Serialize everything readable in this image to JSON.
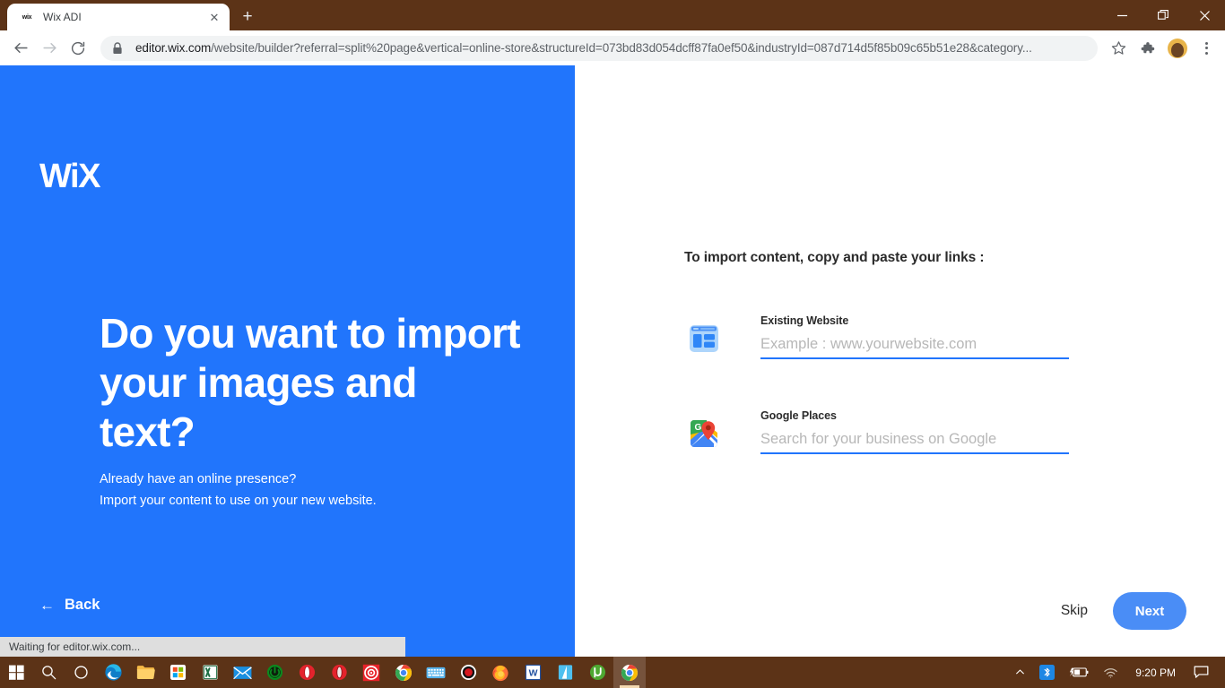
{
  "browser": {
    "tab": {
      "favicon_label": "wix",
      "favicon_icon": "wix-favicon",
      "title": "Wix ADI",
      "close_icon": "close-icon"
    },
    "newtab_icon": "plus-icon",
    "window_controls": {
      "minimize": "minimize-icon",
      "maximize": "restore-icon",
      "close": "close-icon"
    },
    "toolbar": {
      "back_icon": "back-arrow-icon",
      "forward_icon": "forward-arrow-icon",
      "reload_icon": "reload-icon",
      "lock_icon": "lock-icon",
      "url_domain": "editor.wix.com",
      "url_path": "/website/builder?referral=split%20page&vertical=online-store&structureId=073bd83d054dcff87fa0ef50&industryId=087d714d5f85b09c65b51e28&category...",
      "bookmark_icon": "star-icon",
      "extensions_icon": "puzzle-icon",
      "profile_icon": "avatar",
      "menu_icon": "three-dot-menu-icon"
    }
  },
  "hero": {
    "logo": "WiX",
    "heading": "Do you want to import your images and text?",
    "subtitle_line1": "Already have an online presence?",
    "subtitle_line2": "Import your content to use on your new website.",
    "back_label": "Back",
    "back_arrow": "←",
    "background_color": "#2175fc"
  },
  "form": {
    "title": "To import content, copy and paste your links :",
    "fields": [
      {
        "label": "Existing Website",
        "placeholder": "Example : www.yourwebsite.com",
        "value": "",
        "icon": "website-layout-icon"
      },
      {
        "label": "Google Places",
        "placeholder": "Search for your business on Google",
        "value": "",
        "icon": "google-maps-icon"
      }
    ],
    "skip_label": "Skip",
    "next_label": "Next",
    "accent_color": "#2175fc",
    "next_button_color": "#4a8df6"
  },
  "status": {
    "text": "Waiting for editor.wix.com..."
  },
  "taskbar": {
    "background_color": "#5c3317",
    "items": [
      {
        "name": "start-button",
        "icon": "windows-logo-icon"
      },
      {
        "name": "search-button",
        "icon": "search-icon"
      },
      {
        "name": "cortana-button",
        "icon": "cortana-circle-icon"
      },
      {
        "name": "edge-button",
        "icon": "edge-icon"
      },
      {
        "name": "file-explorer-button",
        "icon": "folder-icon"
      },
      {
        "name": "microsoft-store-button",
        "icon": "store-icon"
      },
      {
        "name": "excel-button",
        "icon": "excel-icon"
      },
      {
        "name": "mail-button",
        "icon": "mail-icon"
      },
      {
        "name": "power-app-button",
        "icon": "green-power-icon"
      },
      {
        "name": "opera-button",
        "icon": "opera-icon"
      },
      {
        "name": "opera-gx-button",
        "icon": "opera-gx-icon"
      },
      {
        "name": "target-app-button",
        "icon": "red-target-icon"
      },
      {
        "name": "chrome-button",
        "icon": "chrome-icon"
      },
      {
        "name": "keyboard-button",
        "icon": "keyboard-icon"
      },
      {
        "name": "record-button",
        "icon": "record-dot-icon"
      },
      {
        "name": "firefox-button",
        "icon": "firefox-icon"
      },
      {
        "name": "word-button",
        "icon": "word-icon"
      },
      {
        "name": "blue-app-button",
        "icon": "blue-triangle-icon"
      },
      {
        "name": "utorrent-button",
        "icon": "utorrent-icon"
      },
      {
        "name": "chrome-active-button",
        "icon": "chrome-icon"
      }
    ],
    "tray": {
      "chevron_icon": "chevron-up-icon",
      "bluetooth_icon": "bluetooth-icon",
      "battery_icon": "battery-charging-icon",
      "wifi_icon": "wifi-icon",
      "clock": "9:20 PM",
      "notification_icon": "notification-icon"
    }
  }
}
